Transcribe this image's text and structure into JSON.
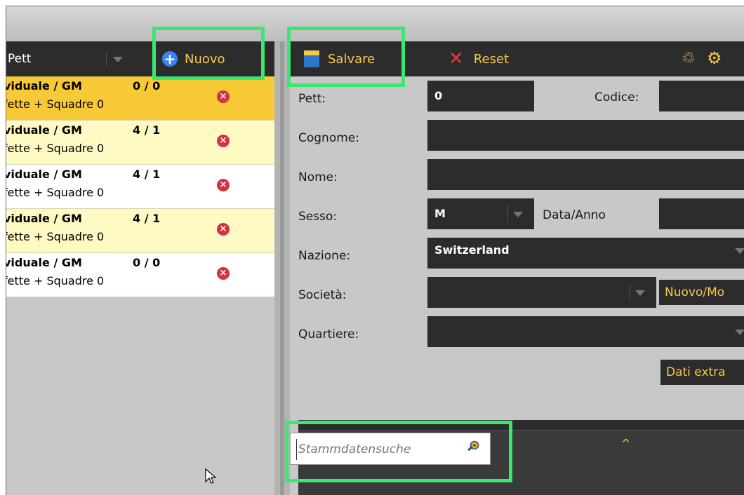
{
  "left": {
    "sort_value": "Pett",
    "new_label": "Nuovo",
    "items": [
      {
        "title": "viduale / GM",
        "counts": "0 / 0",
        "subtitle": "fette + Squadre 0",
        "bg": "#f8c936"
      },
      {
        "title": "viduale / GM",
        "counts": "4 / 1",
        "subtitle": "fette + Squadre 0",
        "bg": "#fff9c4"
      },
      {
        "title": "viduale / GM",
        "counts": "4 / 1",
        "subtitle": "fette + Squadre 0",
        "bg": "#ffffff"
      },
      {
        "title": "viduale / GM",
        "counts": "4 / 1",
        "subtitle": "fette + Squadre 0",
        "bg": "#fff9c4"
      },
      {
        "title": "viduale / GM",
        "counts": "0 / 0",
        "subtitle": "fette + Squadre 0",
        "bg": "#ffffff"
      }
    ]
  },
  "toolbar": {
    "save_label": "Salvare",
    "reset_label": "Reset"
  },
  "form": {
    "pett_label": "Pett:",
    "pett_value": "0",
    "codice_label": "Codice:",
    "cognome_label": "Cognome:",
    "nome_label": "Nome:",
    "sesso_label": "Sesso:",
    "sesso_value": "M",
    "data_label": "Data/Anno",
    "nazione_label": "Nazione:",
    "nazione_value": "Switzerland",
    "societa_label": "Società:",
    "nuovo_mod_label": "Nuovo/Mo",
    "quartiere_label": "Quartiere:",
    "dati_extra_label": "Dati extra",
    "collapse_caret": "^"
  },
  "search": {
    "placeholder": "Stammdatensuche"
  },
  "colors": {
    "accent": "#f7c94a",
    "toolbar_bg": "#2c2c2c",
    "highlight": "#39e86f"
  }
}
